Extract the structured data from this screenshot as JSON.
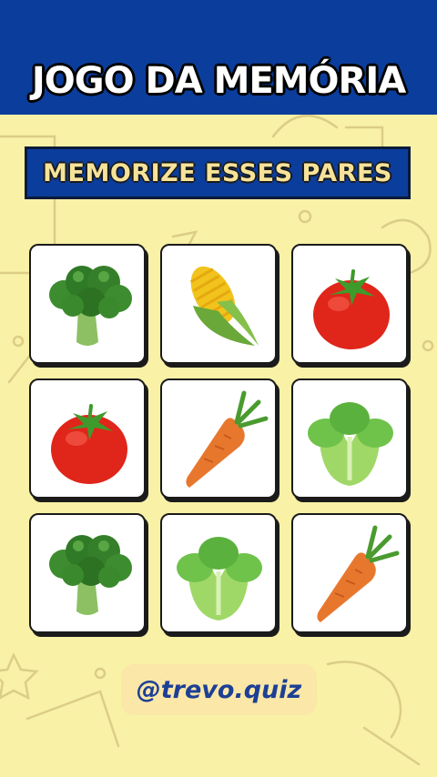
{
  "header": {
    "title": "JOGO DA MEMÓRIA"
  },
  "banner": {
    "text": "MEMORIZE ESSES PARES"
  },
  "board": {
    "cards": [
      {
        "item": "broccoli"
      },
      {
        "item": "corn"
      },
      {
        "item": "tomato"
      },
      {
        "item": "tomato"
      },
      {
        "item": "carrot"
      },
      {
        "item": "lettuce"
      },
      {
        "item": "broccoli"
      },
      {
        "item": "lettuce"
      },
      {
        "item": "carrot"
      }
    ]
  },
  "footer": {
    "handle": "@trevo.quiz"
  },
  "colors": {
    "header_bg": "#0b3d9c",
    "page_bg": "#f8f1a6",
    "banner_text": "#f6e39a",
    "handle_text": "#1d3f95"
  }
}
